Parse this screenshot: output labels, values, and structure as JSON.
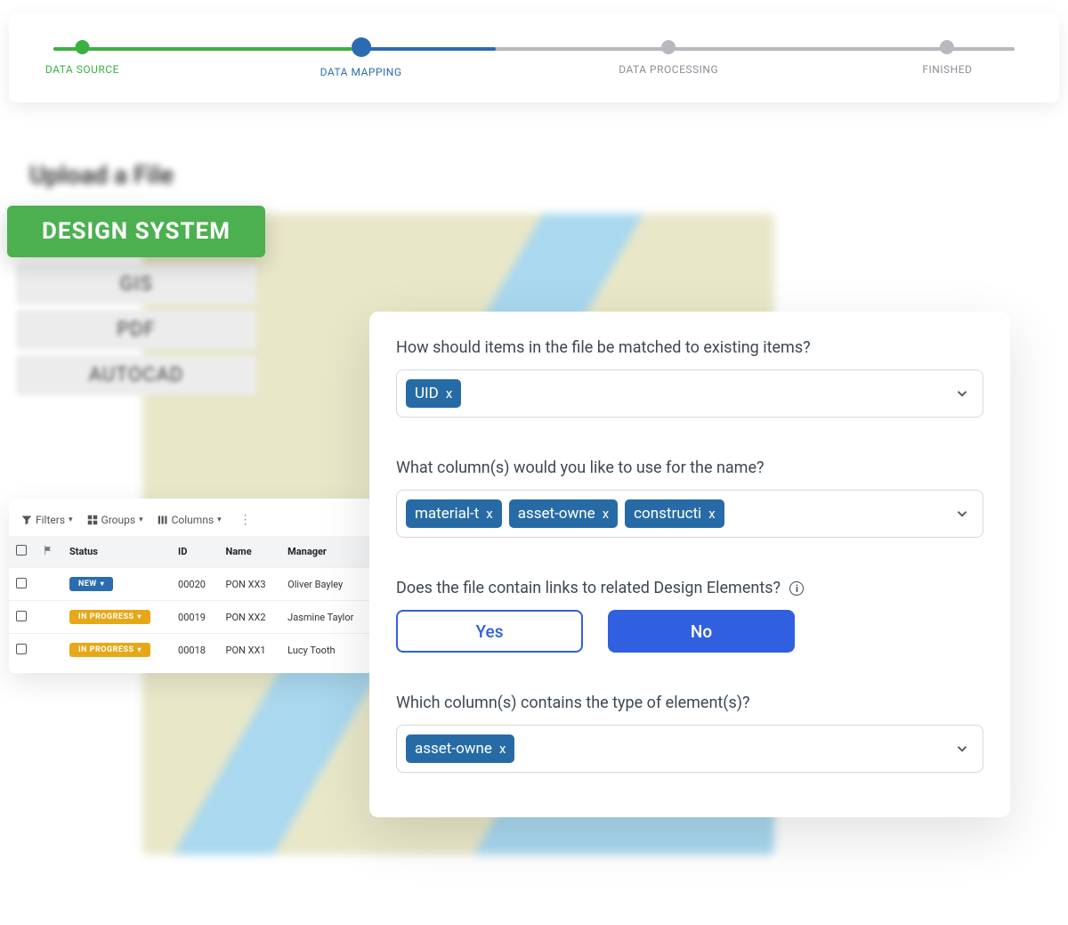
{
  "stepper": {
    "steps": [
      {
        "label": "DATA SOURCE"
      },
      {
        "label": "DATA MAPPING"
      },
      {
        "label": "DATA PROCESSING"
      },
      {
        "label": "FINISHED"
      }
    ]
  },
  "upload": {
    "title": "Upload a File",
    "options": [
      "DESIGN SYSTEM",
      "GIS",
      "PDF",
      "AUTOCAD"
    ],
    "active_index": 0
  },
  "table": {
    "toolbar": {
      "filters": "Filters",
      "groups": "Groups",
      "columns": "Columns"
    },
    "headers": {
      "status": "Status",
      "id": "ID",
      "name": "Name",
      "manager": "Manager"
    },
    "rows": [
      {
        "status_label": "NEW",
        "status_class": "status-new",
        "id": "00020",
        "name": "PON XX3",
        "manager": "Oliver Bayley"
      },
      {
        "status_label": "IN PROGRESS",
        "status_class": "status-inprog",
        "id": "00019",
        "name": "PON XX2",
        "manager": "Jasmine Taylor"
      },
      {
        "status_label": "IN PROGRESS",
        "status_class": "status-inprog",
        "id": "00018",
        "name": "PON XX1",
        "manager": "Lucy Tooth"
      }
    ]
  },
  "form": {
    "q1": {
      "label": "How should items in the file be matched to existing items?",
      "tags": [
        "UID"
      ]
    },
    "q2": {
      "label": "What column(s) would you like to use for the name?",
      "tags": [
        "material-t",
        "asset-owne",
        "constructi"
      ]
    },
    "q3": {
      "label": "Does the file contain links to related Design Elements?",
      "yes": "Yes",
      "no": "No"
    },
    "q4": {
      "label": "Which column(s) contains the type of element(s)?",
      "tags": [
        "asset-owne"
      ]
    },
    "tag_close": "x"
  }
}
